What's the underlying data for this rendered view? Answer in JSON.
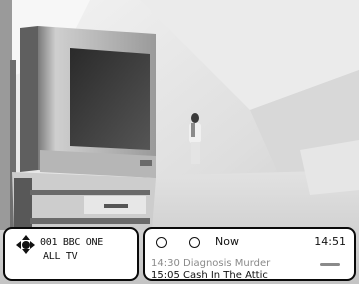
{
  "channel": {
    "name": "001 BBC ONE",
    "group": "ALL TV"
  },
  "programme_info": {
    "now_label": "Now",
    "clock": "14:51",
    "current": "14:30 Diagnosis Murder",
    "next": "15:05 Cash In The Attic"
  },
  "colors": {
    "panel_bg": "#ffffff",
    "panel_border": "#0a0a0a",
    "text": "#111111",
    "muted_text": "#8a8a8a"
  }
}
